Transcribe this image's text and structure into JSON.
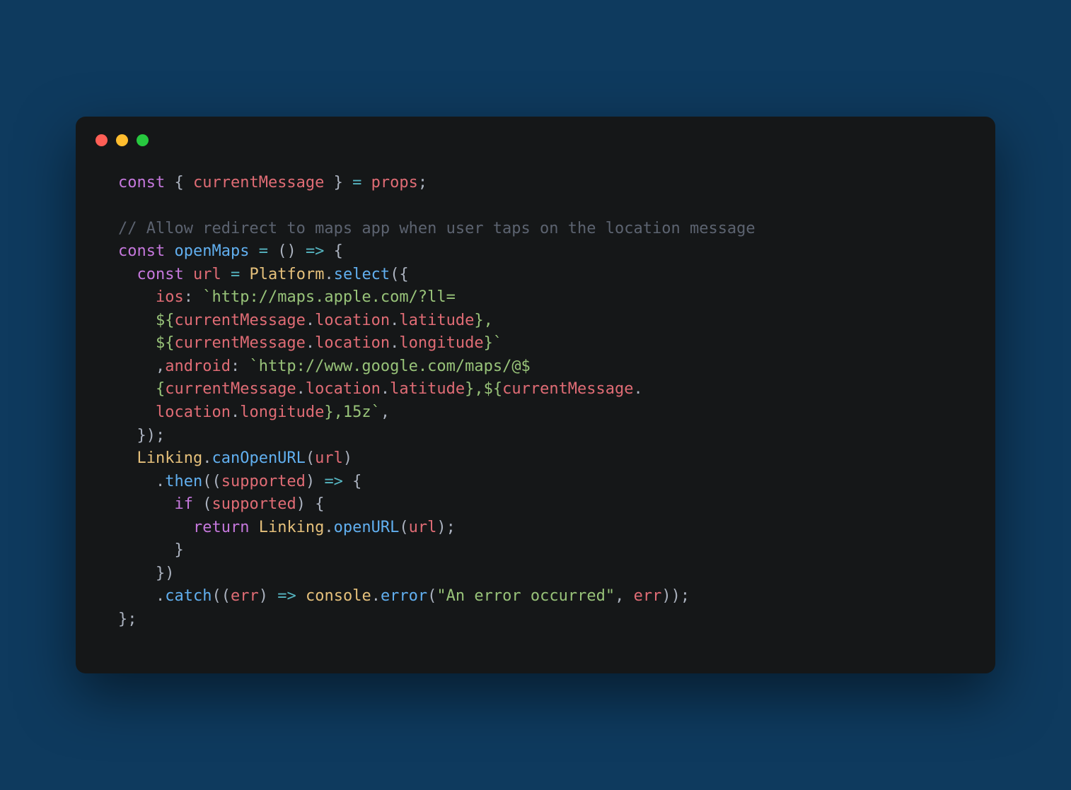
{
  "window": {
    "traffic_lights": [
      "close",
      "minimize",
      "zoom"
    ]
  },
  "code": {
    "tokens": [
      {
        "c": "kw",
        "t": "const"
      },
      {
        "c": "pn",
        "t": " { "
      },
      {
        "c": "id",
        "t": "currentMessage"
      },
      {
        "c": "pn",
        "t": " } "
      },
      {
        "c": "op",
        "t": "="
      },
      {
        "c": "pn",
        "t": " "
      },
      {
        "c": "id",
        "t": "props"
      },
      {
        "c": "pn",
        "t": ";\n\n"
      },
      {
        "c": "cmt",
        "t": "// Allow redirect to maps app when user taps on the location message"
      },
      {
        "c": "pn",
        "t": "\n"
      },
      {
        "c": "kw",
        "t": "const"
      },
      {
        "c": "pn",
        "t": " "
      },
      {
        "c": "fn",
        "t": "openMaps"
      },
      {
        "c": "pn",
        "t": " "
      },
      {
        "c": "op",
        "t": "="
      },
      {
        "c": "pn",
        "t": " () "
      },
      {
        "c": "op",
        "t": "=>"
      },
      {
        "c": "pn",
        "t": " {\n"
      },
      {
        "c": "pn",
        "t": "  "
      },
      {
        "c": "kw",
        "t": "const"
      },
      {
        "c": "pn",
        "t": " "
      },
      {
        "c": "id",
        "t": "url"
      },
      {
        "c": "pn",
        "t": " "
      },
      {
        "c": "op",
        "t": "="
      },
      {
        "c": "pn",
        "t": " "
      },
      {
        "c": "cls",
        "t": "Platform"
      },
      {
        "c": "pn",
        "t": "."
      },
      {
        "c": "fn",
        "t": "select"
      },
      {
        "c": "pn",
        "t": "({\n"
      },
      {
        "c": "pn",
        "t": "    "
      },
      {
        "c": "prop",
        "t": "ios"
      },
      {
        "c": "pn",
        "t": ": "
      },
      {
        "c": "str",
        "t": "`http://maps.apple.com/?ll=\n    ${"
      },
      {
        "c": "id",
        "t": "currentMessage"
      },
      {
        "c": "pn",
        "t": "."
      },
      {
        "c": "id",
        "t": "location"
      },
      {
        "c": "pn",
        "t": "."
      },
      {
        "c": "id",
        "t": "latitude"
      },
      {
        "c": "str",
        "t": "},\n    ${"
      },
      {
        "c": "id",
        "t": "currentMessage"
      },
      {
        "c": "pn",
        "t": "."
      },
      {
        "c": "id",
        "t": "location"
      },
      {
        "c": "pn",
        "t": "."
      },
      {
        "c": "id",
        "t": "longitude"
      },
      {
        "c": "str",
        "t": "}`"
      },
      {
        "c": "pn",
        "t": "\n"
      },
      {
        "c": "pn",
        "t": "    ,"
      },
      {
        "c": "prop",
        "t": "android"
      },
      {
        "c": "pn",
        "t": ": "
      },
      {
        "c": "str",
        "t": "`http://www.google.com/maps/@$\n    {"
      },
      {
        "c": "id",
        "t": "currentMessage"
      },
      {
        "c": "pn",
        "t": "."
      },
      {
        "c": "id",
        "t": "location"
      },
      {
        "c": "pn",
        "t": "."
      },
      {
        "c": "id",
        "t": "latitude"
      },
      {
        "c": "str",
        "t": "},${"
      },
      {
        "c": "id",
        "t": "currentMessage"
      },
      {
        "c": "pn",
        "t": "."
      },
      {
        "c": "str",
        "t": "\n    "
      },
      {
        "c": "id",
        "t": "location"
      },
      {
        "c": "pn",
        "t": "."
      },
      {
        "c": "id",
        "t": "longitude"
      },
      {
        "c": "str",
        "t": "},15z`"
      },
      {
        "c": "pn",
        "t": ",\n"
      },
      {
        "c": "pn",
        "t": "  });\n"
      },
      {
        "c": "pn",
        "t": "  "
      },
      {
        "c": "cls",
        "t": "Linking"
      },
      {
        "c": "pn",
        "t": "."
      },
      {
        "c": "fn",
        "t": "canOpenURL"
      },
      {
        "c": "pn",
        "t": "("
      },
      {
        "c": "id",
        "t": "url"
      },
      {
        "c": "pn",
        "t": ")\n"
      },
      {
        "c": "pn",
        "t": "    ."
      },
      {
        "c": "fn",
        "t": "then"
      },
      {
        "c": "pn",
        "t": "(("
      },
      {
        "c": "id",
        "t": "supported"
      },
      {
        "c": "pn",
        "t": ") "
      },
      {
        "c": "op",
        "t": "=>"
      },
      {
        "c": "pn",
        "t": " {\n"
      },
      {
        "c": "pn",
        "t": "      "
      },
      {
        "c": "kw",
        "t": "if"
      },
      {
        "c": "pn",
        "t": " ("
      },
      {
        "c": "id",
        "t": "supported"
      },
      {
        "c": "pn",
        "t": ") {\n"
      },
      {
        "c": "pn",
        "t": "        "
      },
      {
        "c": "kw",
        "t": "return"
      },
      {
        "c": "pn",
        "t": " "
      },
      {
        "c": "cls",
        "t": "Linking"
      },
      {
        "c": "pn",
        "t": "."
      },
      {
        "c": "fn",
        "t": "openURL"
      },
      {
        "c": "pn",
        "t": "("
      },
      {
        "c": "id",
        "t": "url"
      },
      {
        "c": "pn",
        "t": ");\n"
      },
      {
        "c": "pn",
        "t": "      }\n"
      },
      {
        "c": "pn",
        "t": "    })\n"
      },
      {
        "c": "pn",
        "t": "    ."
      },
      {
        "c": "fn",
        "t": "catch"
      },
      {
        "c": "pn",
        "t": "(("
      },
      {
        "c": "id",
        "t": "err"
      },
      {
        "c": "pn",
        "t": ") "
      },
      {
        "c": "op",
        "t": "=>"
      },
      {
        "c": "pn",
        "t": " "
      },
      {
        "c": "cls",
        "t": "console"
      },
      {
        "c": "pn",
        "t": "."
      },
      {
        "c": "fn",
        "t": "error"
      },
      {
        "c": "pn",
        "t": "("
      },
      {
        "c": "str",
        "t": "\"An error occurred\""
      },
      {
        "c": "pn",
        "t": ", "
      },
      {
        "c": "id",
        "t": "err"
      },
      {
        "c": "pn",
        "t": "));\n"
      },
      {
        "c": "pn",
        "t": "};"
      }
    ]
  }
}
